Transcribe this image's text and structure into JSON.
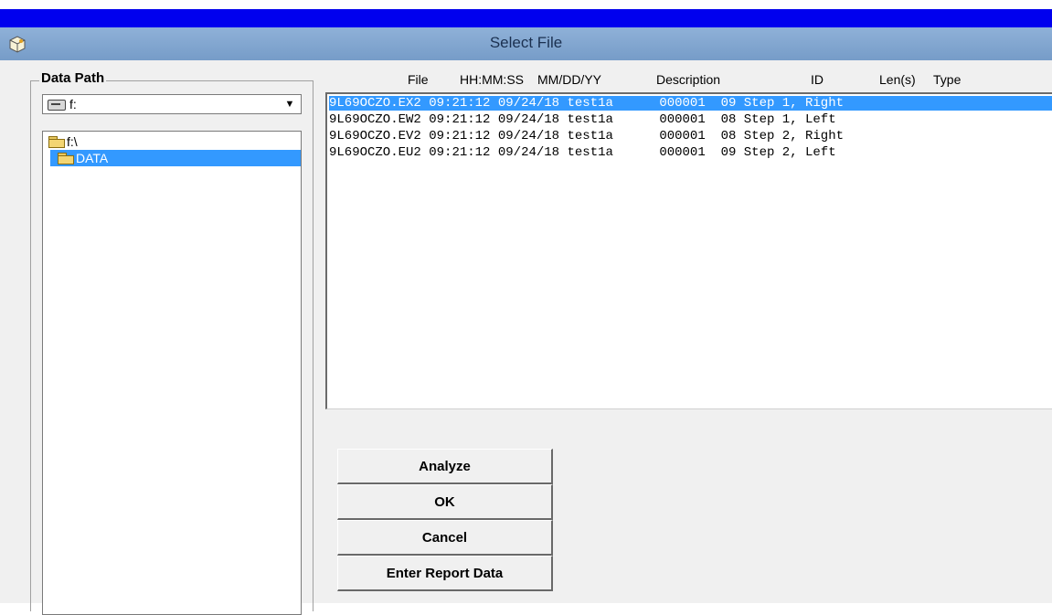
{
  "window": {
    "title": "Select File",
    "icon": "app-icon"
  },
  "data_path": {
    "group_label": "Data Path",
    "drive_value": "f:",
    "drive_icon": "drive-icon",
    "tree": [
      {
        "label": "f:\\",
        "icon": "folder-open-icon"
      },
      {
        "label": "DATA",
        "icon": "folder-open-icon",
        "selected": true
      }
    ]
  },
  "file_list": {
    "columns": [
      "File",
      "HH:MM:SS",
      "MM/DD/YY",
      "Description",
      "ID",
      "Len(s)",
      "Type"
    ],
    "rows": [
      {
        "file": "9L69OCZO.EX2",
        "time": "09:21:12",
        "date": "09/24/18",
        "description": "test1a",
        "id": "000001",
        "len": "09",
        "type": "Step 1, Right",
        "selected": true
      },
      {
        "file": "9L69OCZO.EW2",
        "time": "09:21:12",
        "date": "09/24/18",
        "description": "test1a",
        "id": "000001",
        "len": "08",
        "type": "Step 1, Left"
      },
      {
        "file": "9L69OCZO.EV2",
        "time": "09:21:12",
        "date": "09/24/18",
        "description": "test1a",
        "id": "000001",
        "len": "08",
        "type": "Step 2, Right"
      },
      {
        "file": "9L69OCZO.EU2",
        "time": "09:21:12",
        "date": "09/24/18",
        "description": "test1a",
        "id": "000001",
        "len": "09",
        "type": "Step 2, Left"
      }
    ]
  },
  "buttons": {
    "analyze": "Analyze",
    "ok": "OK",
    "cancel": "Cancel",
    "enter_report": "Enter Report Data"
  },
  "colors": {
    "title_bar": "#8fb1d8",
    "top_bar": "#0000ee",
    "selection": "#3399ff"
  }
}
